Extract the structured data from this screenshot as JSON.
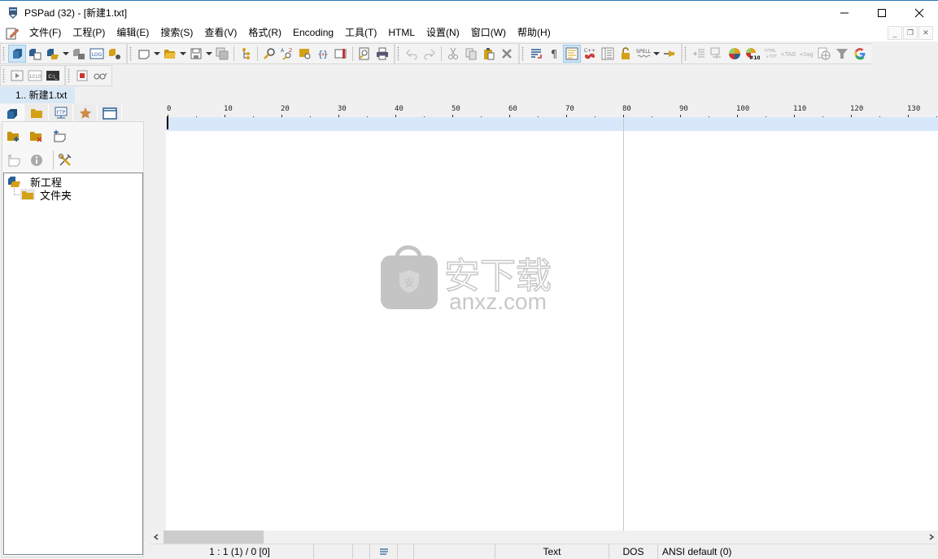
{
  "window": {
    "title": "PSPad (32) - [新建1.txt]",
    "controls": {
      "minimize": "—",
      "maximize": "☐",
      "close": "✕"
    }
  },
  "menu": {
    "items": [
      "文件(F)",
      "工程(P)",
      "编辑(E)",
      "搜索(S)",
      "查看(V)",
      "格式(R)",
      "Encoding",
      "工具(T)",
      "HTML",
      "设置(N)",
      "窗口(W)",
      "帮助(H)"
    ],
    "mdi_controls": {
      "minimize": "_",
      "restore": "❐",
      "close": "✕"
    }
  },
  "toolbar": {
    "project_group": [
      "project",
      "new-project-file",
      "open-project",
      "close-project",
      "log",
      "project-settings"
    ],
    "file_group": [
      "new-file",
      "open-file",
      "save-file",
      "save-all",
      "file-tree",
      "find",
      "replace",
      "find-in-files",
      "bracket-match",
      "bookmarks",
      "print-preview",
      "print",
      "undo",
      "redo",
      "cut",
      "copy",
      "paste",
      "delete"
    ],
    "format_group": [
      "word-wrap",
      "show-special-chars",
      "text-view",
      "code-explorer",
      "line-numbers",
      "read-only",
      "spell-check",
      "pin"
    ],
    "html_group": [
      "indent",
      "format-html",
      "color-picker",
      "color-hex",
      "html-to-text",
      "tag-uppercase",
      "tag-lowercase",
      "web-browser",
      "filter",
      "google-search"
    ],
    "spell_label": "SPELL",
    "html_txt_label": "HTML\n↳TXT",
    "tag_upper_label": "<TAG",
    "tag_lower_label": "<tag"
  },
  "macro_toolbar": {
    "buttons": [
      "run",
      "binary",
      "console",
      "record-macro",
      "glasses"
    ],
    "binary_label": "1010",
    "console_label": "C:\\_"
  },
  "document_tabs": [
    {
      "label": "1.. 新建1.txt",
      "active": true
    }
  ],
  "side_panel": {
    "tabs": [
      "project",
      "folder",
      "ftp",
      "favorites",
      "windows"
    ],
    "ftp_label": "FTP",
    "tree": [
      {
        "label": "新工程",
        "level": 0,
        "icon": "project-icon"
      },
      {
        "label": "文件夹",
        "level": 1,
        "icon": "folder-icon"
      }
    ]
  },
  "ruler": {
    "labels": [
      "0",
      "10",
      "20",
      "30",
      "40",
      "50",
      "60",
      "70",
      "80",
      "90",
      "100",
      "110",
      "120",
      "130"
    ],
    "right_margin_column": 80
  },
  "watermark": {
    "cn_text": "安下载",
    "en_text": "anxz.com",
    "badge_char": "安"
  },
  "status_bar": {
    "position": "1 : 1 (1) / 0  [0]",
    "syntax": "Text",
    "line_ending": "DOS",
    "encoding": "ANSI default (0)"
  },
  "colors": {
    "current_line": "#d8e8fa",
    "doc_tab_active": "#d9e8f7",
    "folder": "#d4a017",
    "accent_blue": "#2b5f93"
  }
}
